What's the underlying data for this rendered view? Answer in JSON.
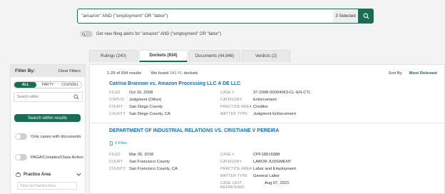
{
  "search": {
    "query": "\"amazon\" AND (\"employment\" OR \"labor\")",
    "selected": "3 Selected"
  },
  "alert": {
    "text": "Get new filing alerts for \"amazon\" AND (\"employment\" OR \"labor\")"
  },
  "filters": {
    "title": "Filter By:",
    "clear": "Clear Filters",
    "segments": [
      "ALL",
      "PARTY",
      "COUNSEL"
    ],
    "search_placeholder": "Search within",
    "search_button": "Search within results",
    "only_docs": "Only cases with documents",
    "paga": "PAGA/Complex/Class Action",
    "practice_area": "Practice Area",
    "practice_placeholder": "Filter by Practice Area"
  },
  "tabs": [
    {
      "label": "Rulings (240)"
    },
    {
      "label": "Dockets (934)"
    },
    {
      "label": "Documents (44,946)"
    },
    {
      "label": "Verdicts (2)"
    }
  ],
  "results": {
    "range": "1-25 of 934 results",
    "found_prefix": "We found",
    "found_num": "241 FL",
    "found_suffix": "dockets",
    "sort_label": "Sort By",
    "sort_value": "Most Relevant"
  },
  "cases": [
    {
      "title": "Catrina Brannon vs. Amazon Processing LLC A DE LLC",
      "left": [
        {
          "k": "FILED",
          "v": "Oct 16, 2008"
        },
        {
          "k": "STATUS",
          "v": "Judgment (Other)"
        },
        {
          "k": "COURT",
          "v": "San Diego County"
        },
        {
          "k": "COUNTY",
          "v": "San Diego County, CA"
        }
      ],
      "right": [
        {
          "k": "CASE #",
          "v": "37-2008-00094063-CL-EN-CTL"
        },
        {
          "k": "CATEGORY",
          "v": "Enforcement"
        },
        {
          "k": "PRACTICE AREA",
          "v": "Creditor"
        },
        {
          "k": "MATTER TYPE",
          "v": "Judgment Enforcement"
        }
      ]
    },
    {
      "title": "DEPARTMENT OF INDUSTRIAL RELATIONS VS. CRISTIANE V PEREIRA",
      "files": "2 Files",
      "left": [
        {
          "k": "FILED",
          "v": "Mar 05, 2018"
        },
        {
          "k": "COURT",
          "v": "San Francisco County"
        },
        {
          "k": "COUNTY",
          "v": "San Francisco County, CA"
        }
      ],
      "right": [
        {
          "k": "CASE #",
          "v": "CPF18516088"
        },
        {
          "k": "CATEGORY",
          "v": "LABOR JUDGMENT"
        },
        {
          "k": "PRACTICE AREA",
          "v": "Labor and Employment"
        },
        {
          "k": "MATTER TYPE",
          "v": "General Labor"
        },
        {
          "k": "CASE LAST REFRESHED",
          "v": "Aug 07, 2021"
        }
      ]
    }
  ]
}
